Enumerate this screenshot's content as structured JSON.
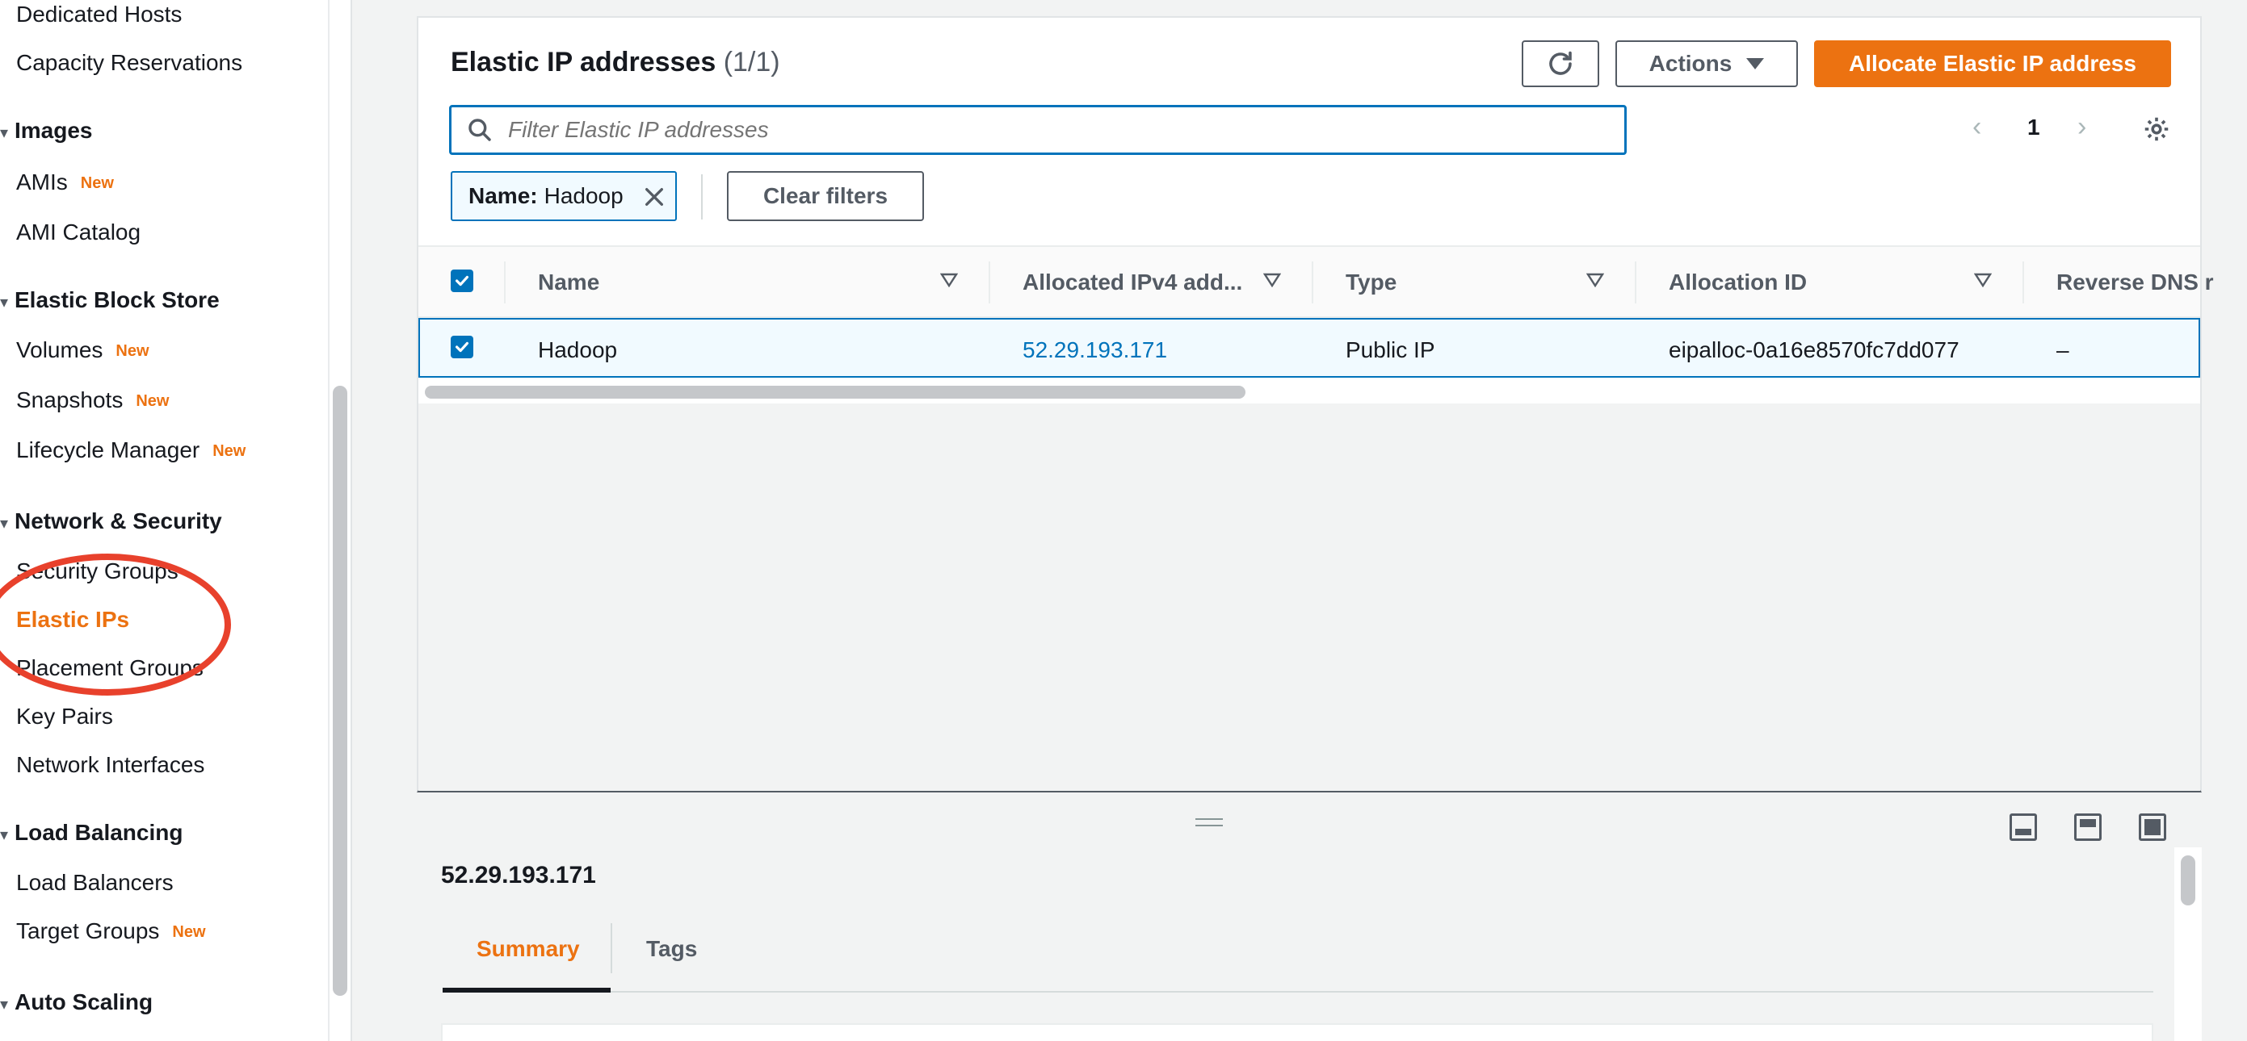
{
  "sidebar": {
    "items": {
      "dedicated_hosts": "Dedicated Hosts",
      "capacity_reservations": "Capacity Reservations",
      "amis": "AMIs",
      "ami_catalog": "AMI Catalog",
      "volumes": "Volumes",
      "snapshots": "Snapshots",
      "lifecycle_manager": "Lifecycle Manager",
      "security_groups": "Security Groups",
      "elastic_ips": "Elastic IPs",
      "placement_groups": "Placement Groups",
      "key_pairs": "Key Pairs",
      "network_interfaces": "Network Interfaces",
      "load_balancers": "Load Balancers",
      "target_groups": "Target Groups"
    },
    "sections": {
      "images": "Images",
      "ebs": "Elastic Block Store",
      "network": "Network & Security",
      "load_balancing": "Load Balancing",
      "auto_scaling": "Auto Scaling"
    },
    "new_badge": "New",
    "active_item": "Elastic IPs"
  },
  "main": {
    "title": "Elastic IP addresses",
    "count": "(1/1)",
    "actions_label": "Actions",
    "allocate_label": "Allocate Elastic IP address",
    "search_placeholder": "Filter Elastic IP addresses",
    "page_number": "1",
    "filter_token": {
      "key": "Name:",
      "value": "Hadoop"
    },
    "clear_filters_label": "Clear filters",
    "columns": [
      "Name",
      "Allocated IPv4 add...",
      "Type",
      "Allocation ID",
      "Reverse DNS r"
    ],
    "rows": [
      {
        "name": "Hadoop",
        "ip": "52.29.193.171",
        "type": "Public IP",
        "allocation_id": "eipalloc-0a16e8570fc7dd077",
        "reverse_dns": "–"
      }
    ]
  },
  "detail": {
    "title": "52.29.193.171",
    "tabs": [
      "Summary",
      "Tags"
    ]
  },
  "colors": {
    "accent": "#ec7211",
    "link": "#0073bb",
    "annotation": "#e8412c"
  }
}
